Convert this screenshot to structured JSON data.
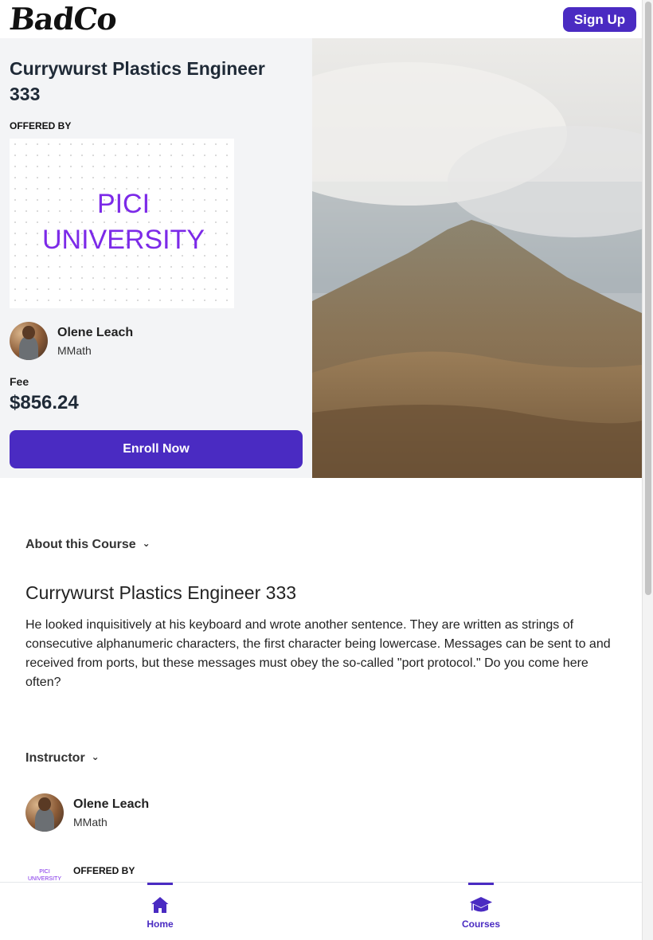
{
  "header": {
    "logo": "BadCo",
    "signup_label": "Sign Up"
  },
  "course": {
    "title": "Currywurst Plastics Engineer 333",
    "offered_by_label": "OFFERED BY",
    "university_line1": "PICI",
    "university_line2": "UNIVERSITY",
    "fee_label": "Fee",
    "fee_value": "$856.24",
    "enroll_label": "Enroll Now"
  },
  "instructor": {
    "name": "Olene Leach",
    "degree": "MMath"
  },
  "about": {
    "heading": "About this Course",
    "title": "Currywurst Plastics Engineer 333",
    "description": "He looked inquisitively at his keyboard and wrote another sentence. They are written as strings of consecutive alphanumeric characters, the first character being lowercase. Messages can be sent to and received from ports, but these messages must obey the so-called \"port protocol.\" Do you come here often?"
  },
  "instructor_section": {
    "heading": "Instructor",
    "offered_by_label": "OFFERED BY"
  },
  "nav": {
    "home_label": "Home",
    "courses_label": "Courses"
  },
  "colors": {
    "accent": "#4a2bc2",
    "university": "#7c2ae8"
  }
}
